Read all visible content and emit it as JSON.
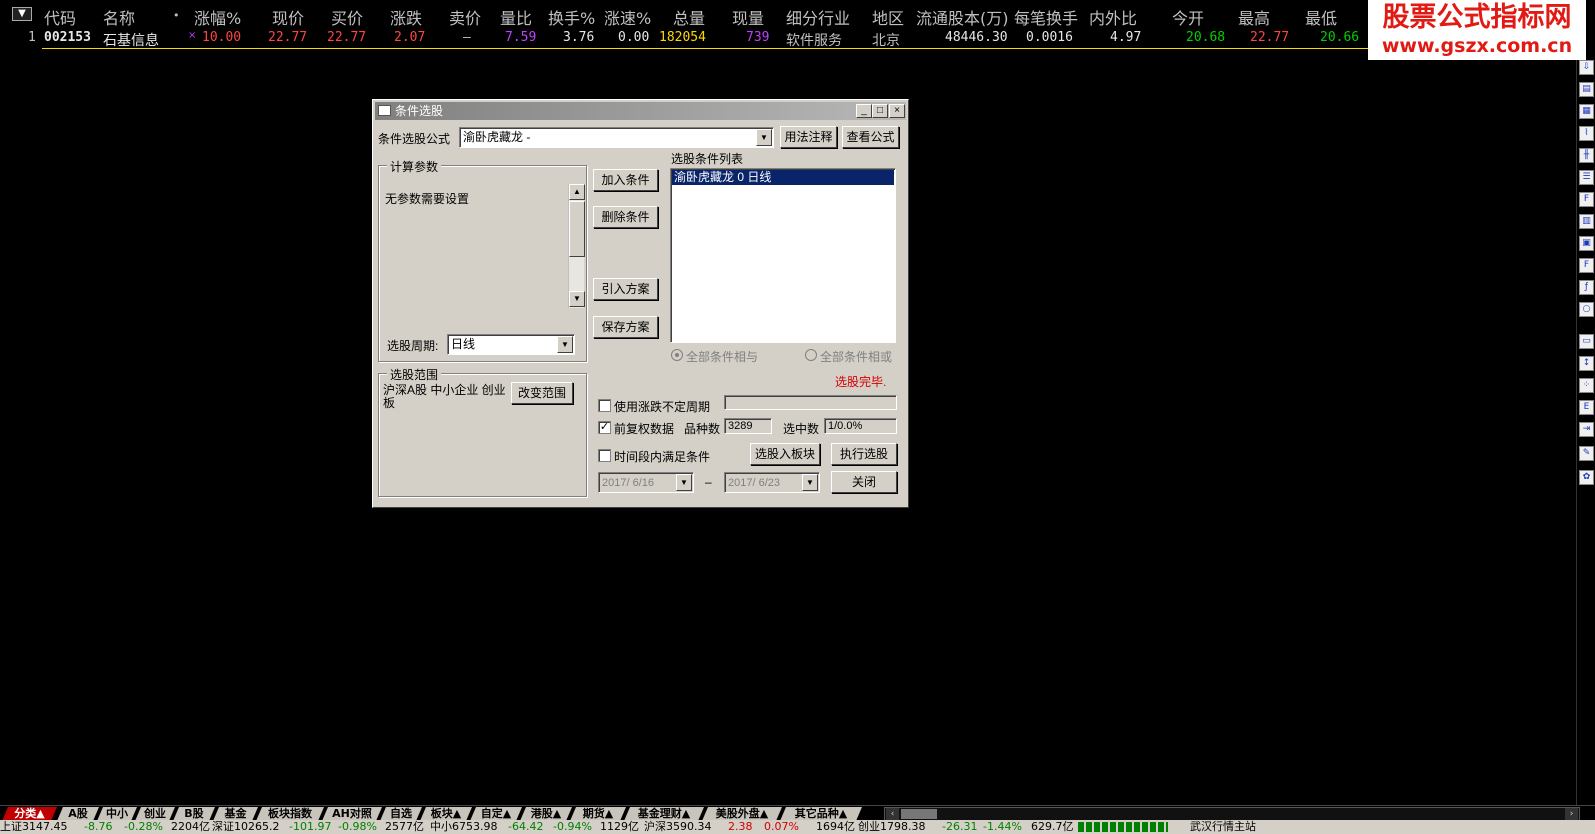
{
  "header": {
    "columns": [
      "代码",
      "名称",
      "•",
      "涨幅%",
      "现价",
      "买价",
      "涨跌",
      "卖价",
      "量比",
      "换手%",
      "涨速%",
      "总量",
      "现量",
      "细分行业",
      "地区",
      "流通股本(万)",
      "每笔换手",
      "内外比",
      "今开",
      "最高",
      "最低"
    ]
  },
  "row": {
    "index": "1",
    "code": "002153",
    "name": "石基信息",
    "mark": "×",
    "change_pct": "10.00",
    "price": "22.77",
    "bid": "22.77",
    "change": "2.07",
    "ask": "–",
    "vol_ratio": "7.59",
    "turnover": "3.76",
    "speed": "0.00",
    "total_vol": "182054",
    "cur_vol": "739",
    "industry": "软件服务",
    "region": "北京",
    "float_shares": "48446.30",
    "per_trade": "0.0016",
    "in_out": "4.97",
    "open": "20.68",
    "high": "22.77",
    "low": "20.66"
  },
  "logo": {
    "line1": "股票公式指标网",
    "line2": "www.gszx.com.cn"
  },
  "dialog": {
    "title": "条件选股",
    "formula_label": "条件选股公式",
    "formula_value": "渝卧虎藏龙 -",
    "usage_btn": "用法注释",
    "view_btn": "查看公式",
    "params_group": "计算参数",
    "params_text": "无参数需要设置",
    "period_label": "选股周期:",
    "period_value": "日线",
    "scope_group": "选股范围",
    "scope_text": "沪深A股 中小企业 创业板",
    "change_scope_btn": "改变范围",
    "add_btn": "加入条件",
    "del_btn": "删除条件",
    "import_btn": "引入方案",
    "save_btn": "保存方案",
    "list_label": "选股条件列表",
    "list_items": [
      "渝卧虎藏龙  0  日线"
    ],
    "radio_and": "全部条件相与",
    "radio_or": "全部条件相或",
    "status": "选股完毕.",
    "opt_unfixed": "使用涨跌不定周期",
    "opt_adjust": "前复权数据",
    "count_label": "品种数",
    "count_value": "3289",
    "selected_label": "选中数",
    "selected_value": "1/0.0%",
    "opt_timespan": "时间段内满足条件",
    "to_block_btn": "选股入板块",
    "run_btn": "执行选股",
    "date_from": "2017/ 6/16",
    "date_sep": "–",
    "date_to": "2017/ 6/23",
    "close_btn": "关闭"
  },
  "tabs": [
    "分类▲",
    "A股",
    "中小",
    "创业",
    "B股",
    "基金",
    "板块指数",
    "AH对照",
    "自选",
    "板块▲",
    "自定▲",
    "港股▲",
    "期货▲",
    "基金理财▲",
    "美股外盘▲",
    "其它品种▲"
  ],
  "status": {
    "sh": "上证3147.45",
    "sh_chg": "-8.76",
    "sh_pct": "-0.28%",
    "sh_amt": "2204亿",
    "sz": "深证10265.2",
    "sz_chg": "-101.97",
    "sz_pct": "-0.98%",
    "sz_amt": "2577亿",
    "zx": "中小6753.98",
    "zx_chg": "-64.42",
    "zx_pct": "-0.94%",
    "zx_amt": "1129亿",
    "hs": "沪深3590.34",
    "hs_chg": "2.38",
    "hs_pct": "0.07%",
    "hs_amt": "1694亿",
    "cy": "创业1798.38",
    "cy_chg": "-26.31",
    "cy_pct": "-1.44%",
    "cy_amt": "629.7亿",
    "site": "武汉行情主站"
  },
  "colors": {
    "up": "#ff4444",
    "down": "#00d000",
    "vol": "#ffd700",
    "purple": "#c040ff"
  }
}
